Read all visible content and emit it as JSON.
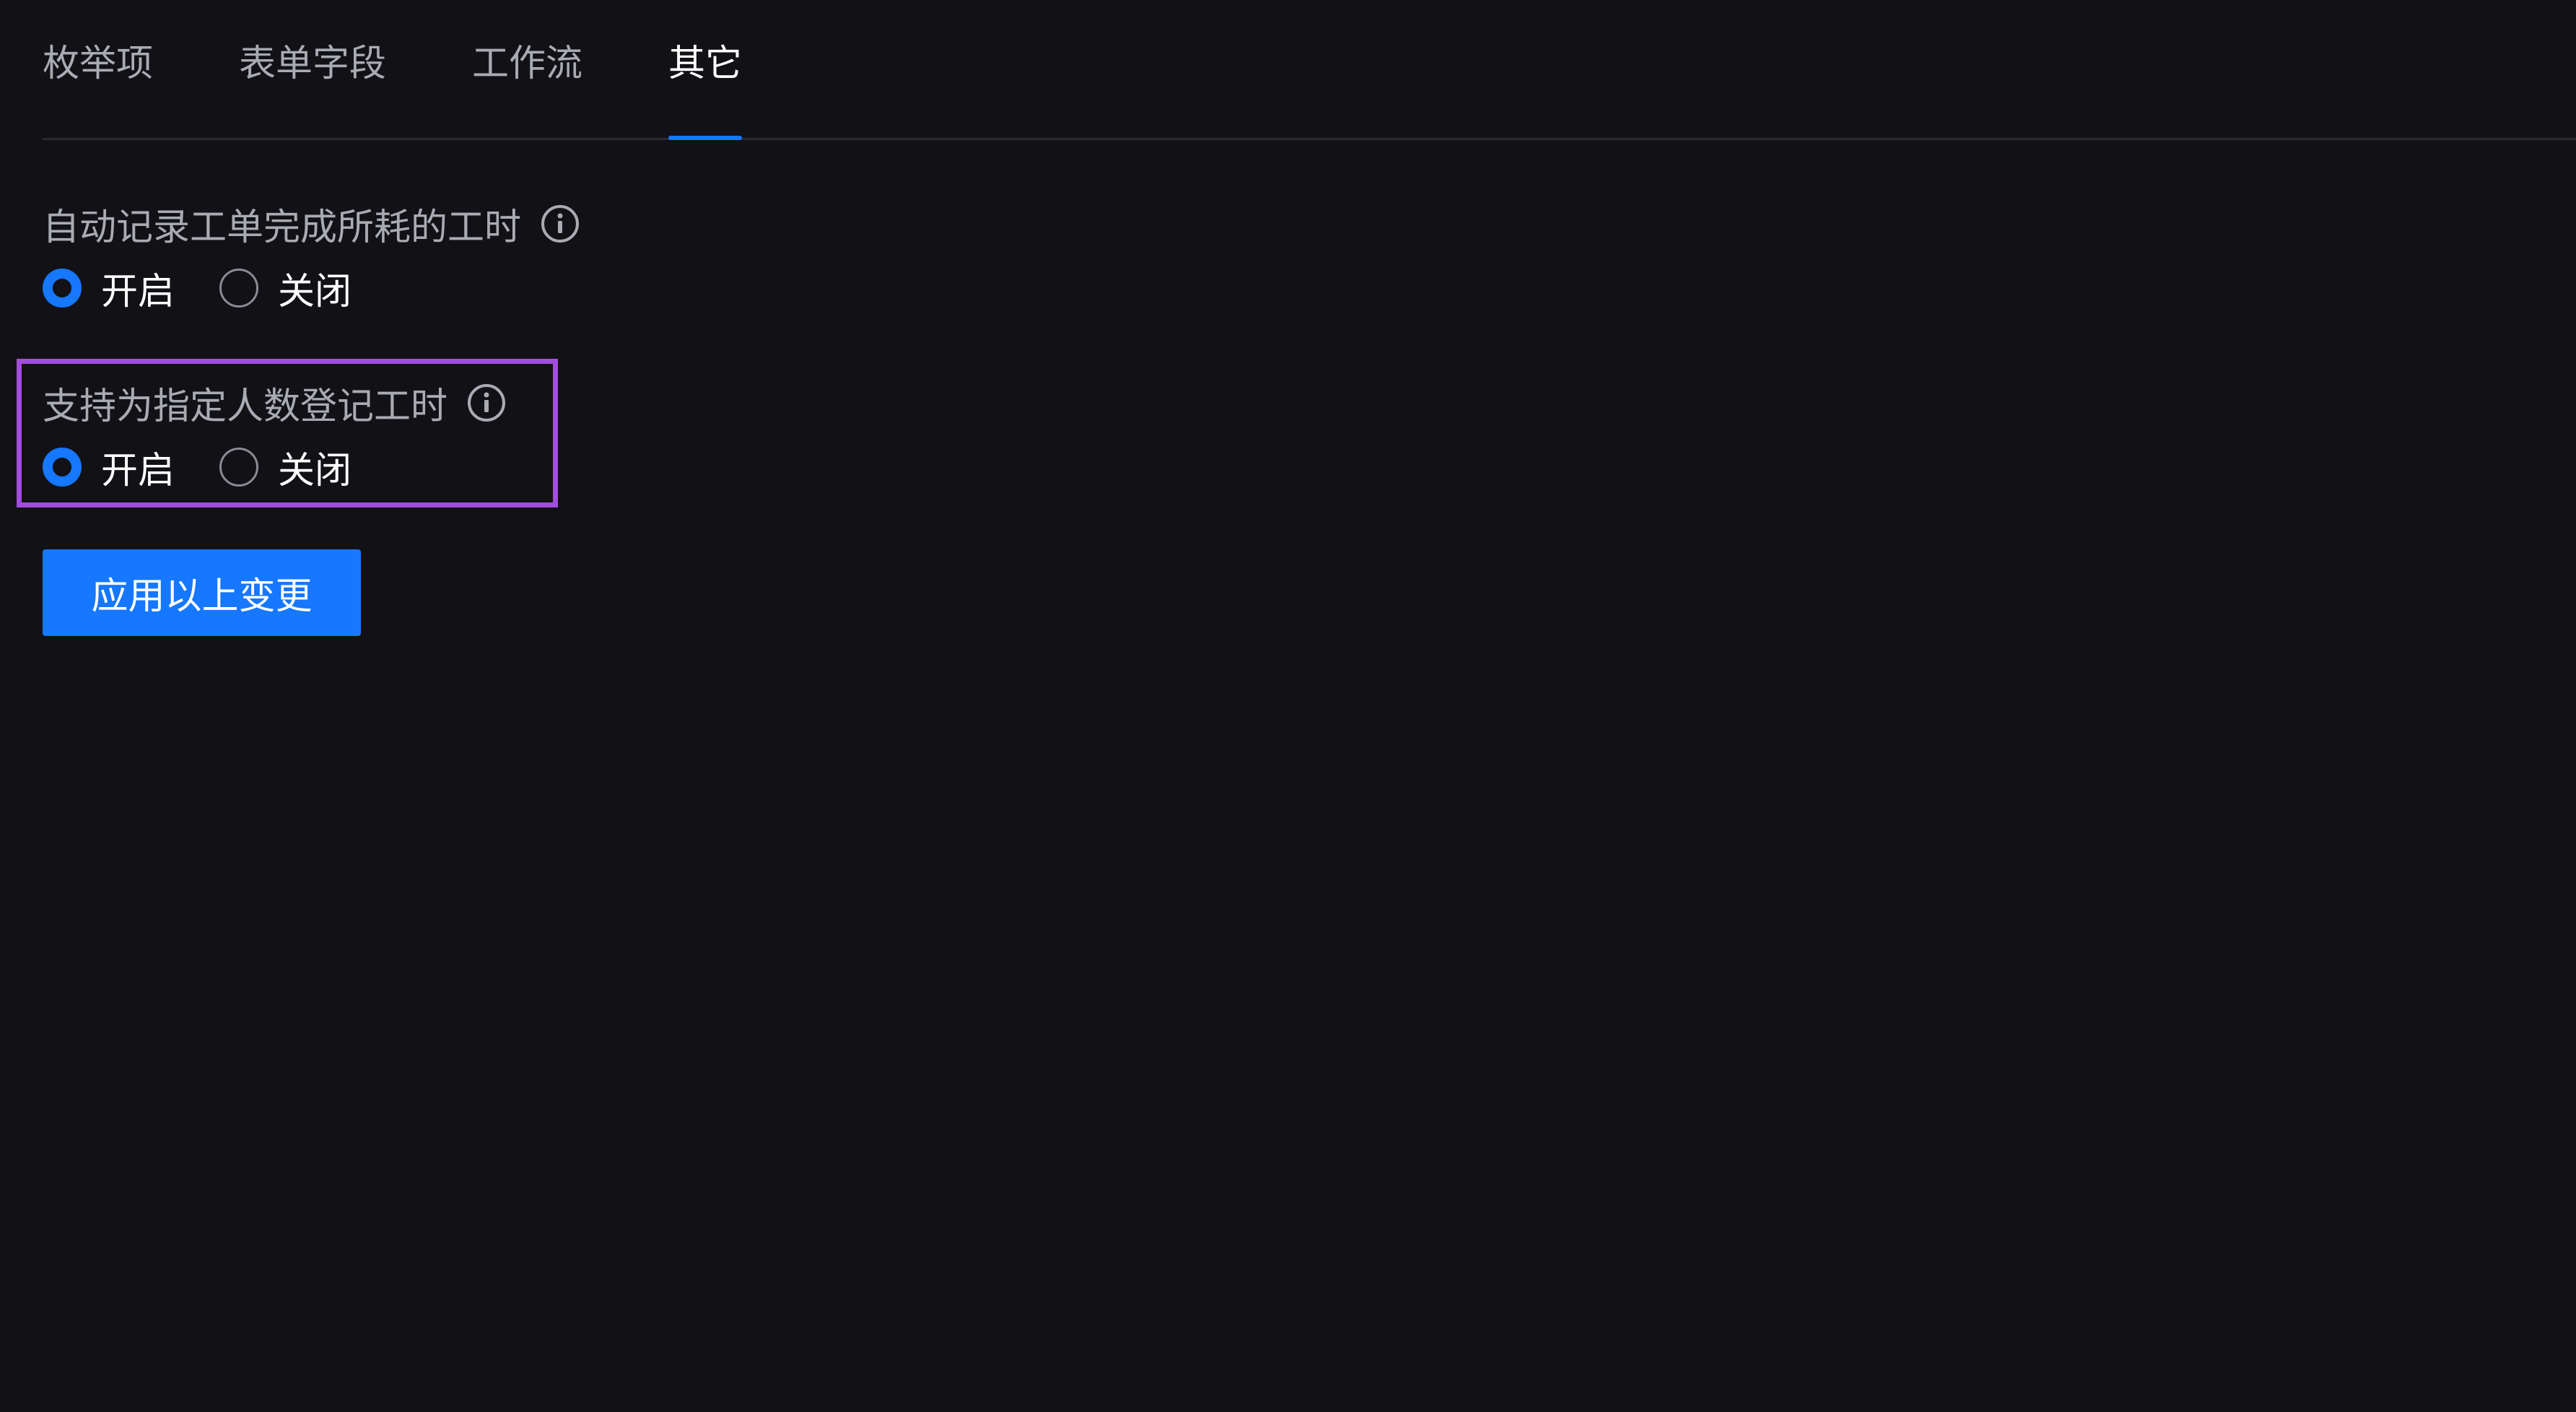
{
  "tabs": [
    {
      "label": "枚举项",
      "active": false
    },
    {
      "label": "表单字段",
      "active": false
    },
    {
      "label": "工作流",
      "active": false
    },
    {
      "label": "其它",
      "active": true
    }
  ],
  "settings": [
    {
      "title": "自动记录工单完成所耗的工时",
      "info_icon": "info-circle-icon",
      "options": [
        {
          "label": "开启",
          "checked": true
        },
        {
          "label": "关闭",
          "checked": false
        }
      ]
    },
    {
      "title": "支持为指定人数登记工时",
      "info_icon": "info-circle-icon",
      "options": [
        {
          "label": "开启",
          "checked": true
        },
        {
          "label": "关闭",
          "checked": false
        }
      ],
      "highlighted": true
    }
  ],
  "apply_button": {
    "label": "应用以上变更"
  },
  "colors": {
    "background": "#111116",
    "accent": "#1677ff",
    "highlight": "#a24ddf",
    "muted_text": "#a9abb2"
  }
}
